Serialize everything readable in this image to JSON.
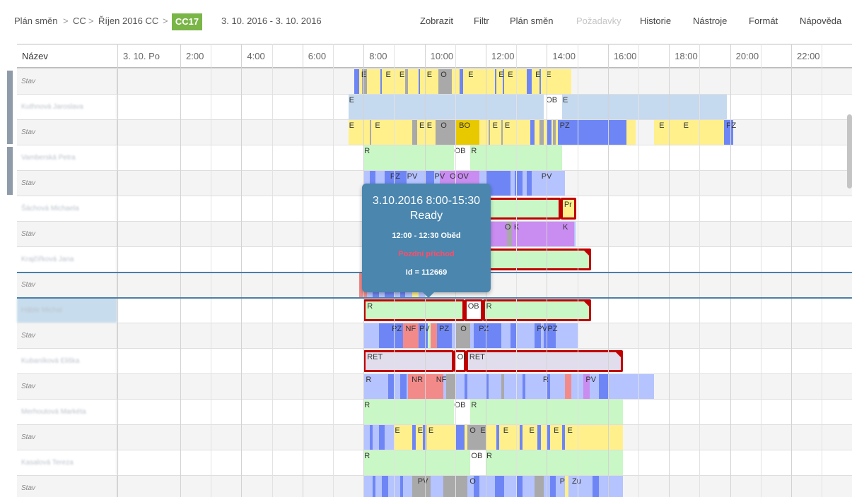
{
  "breadcrumb": {
    "items": [
      "Plán směn",
      "CC",
      "Říjen 2016 CC"
    ],
    "separator": ">",
    "active": "CC17"
  },
  "date_range": "3. 10. 2016 - 3. 10. 2016",
  "menu": [
    {
      "label": "Zobrazit",
      "enabled": true
    },
    {
      "label": "Filtr",
      "enabled": true
    },
    {
      "label": "Plán směn",
      "enabled": true
    },
    {
      "label": "Požadavky",
      "enabled": false
    },
    {
      "label": "Historie",
      "enabled": true
    },
    {
      "label": "Nástroje",
      "enabled": true
    },
    {
      "label": "Formát",
      "enabled": true
    },
    {
      "label": "Nápověda",
      "enabled": true
    }
  ],
  "grid": {
    "name_header": "Název",
    "day_header": "3. 10. Po",
    "hours": [
      "2:00",
      "4:00",
      "6:00",
      "8:00",
      "10:00",
      "12:00",
      "14:00",
      "16:00",
      "18:00",
      "20:00",
      "22:00"
    ],
    "rows": [
      {
        "name": "Stav",
        "kind": "stav"
      },
      {
        "name": "Kuthnová Jaroslava",
        "kind": "person"
      },
      {
        "name": "Stav",
        "kind": "stav"
      },
      {
        "name": "Vamberská Petra",
        "kind": "person"
      },
      {
        "name": "Stav",
        "kind": "stav"
      },
      {
        "name": "Šáchová Michaela",
        "kind": "person"
      },
      {
        "name": "Stav",
        "kind": "stav"
      },
      {
        "name": "Krajčířková Jana",
        "kind": "person"
      },
      {
        "name": "Stav",
        "kind": "stav"
      },
      {
        "name": "Háble Michal",
        "kind": "person",
        "selected": true
      },
      {
        "name": "Stav",
        "kind": "stav"
      },
      {
        "name": "Kubaníková Eliška",
        "kind": "person"
      },
      {
        "name": "Stav",
        "kind": "stav"
      },
      {
        "name": "Merhoutová Markéta",
        "kind": "person"
      },
      {
        "name": "Stav",
        "kind": "stav"
      },
      {
        "name": "Kasalová Tereza",
        "kind": "person"
      },
      {
        "name": "Stav",
        "kind": "stav"
      }
    ]
  },
  "colors": {
    "yellow": "#fff08c",
    "lightblue": "#c5d9ef",
    "green": "#c9f7c5",
    "blue": "#6e86f5",
    "lightviolet": "#b5c3ff",
    "violet": "#c98cf0",
    "gray": "#a9a9a9",
    "red": "#f38a8a",
    "gold": "#e8c900",
    "retfill": "#e2ddec",
    "shiftborder": "#c00000",
    "badge": "#7ab547",
    "tooltip": "#4a86ae"
  },
  "segments": [
    {
      "row": 0,
      "items": [
        {
          "s": 7.7,
          "e": 14.8,
          "c": "yellow"
        },
        {
          "s": 7.7,
          "e": 7.85,
          "c": "blue"
        },
        {
          "s": 7.95,
          "e": 8.1,
          "c": "gray"
        },
        {
          "s": 8.55,
          "e": 8.6,
          "c": "blue"
        },
        {
          "s": 9.35,
          "e": 9.45,
          "c": "gray"
        },
        {
          "s": 9.8,
          "e": 9.85,
          "c": "blue"
        },
        {
          "s": 10.45,
          "e": 10.9,
          "c": "gray"
        },
        {
          "s": 11.15,
          "e": 11.25,
          "c": "blue"
        },
        {
          "s": 12.3,
          "e": 12.35,
          "c": "blue"
        },
        {
          "s": 12.55,
          "e": 12.6,
          "c": "blue"
        },
        {
          "s": 13.35,
          "e": 13.5,
          "c": "blue"
        },
        {
          "s": 13.75,
          "e": 13.8,
          "c": "blue"
        }
      ],
      "labels": [
        {
          "t": "E",
          "x": 7.9
        },
        {
          "t": "E",
          "x": 8.7
        },
        {
          "t": "E",
          "x": 9.15
        },
        {
          "t": "E",
          "x": 10.05
        },
        {
          "t": "O",
          "x": 10.5
        },
        {
          "t": "E",
          "x": 11.4
        },
        {
          "t": "E",
          "x": 12.4
        },
        {
          "t": "E",
          "x": 12.7
        },
        {
          "t": "E",
          "x": 13.6
        },
        {
          "t": "E",
          "x": 13.95
        }
      ]
    },
    {
      "row": 1,
      "items": [
        {
          "s": 7.5,
          "e": 13.9,
          "c": "lightblue"
        },
        {
          "s": 14.5,
          "e": 19.9,
          "c": "lightblue"
        }
      ],
      "labels": [
        {
          "t": "E",
          "x": 7.5
        },
        {
          "t": "OB",
          "x": 13.95
        },
        {
          "t": "E",
          "x": 14.5
        }
      ]
    },
    {
      "row": 2,
      "items": [
        {
          "s": 7.5,
          "e": 16.9,
          "c": "yellow"
        },
        {
          "s": 17.5,
          "e": 19.9,
          "c": "yellow"
        },
        {
          "s": 8.2,
          "e": 8.25,
          "c": "gray"
        },
        {
          "s": 9.6,
          "e": 9.75,
          "c": "gray"
        },
        {
          "s": 10.35,
          "e": 11.0,
          "c": "gray"
        },
        {
          "s": 11.0,
          "e": 11.8,
          "c": "gold"
        },
        {
          "s": 12.1,
          "e": 12.15,
          "c": "gray"
        },
        {
          "s": 12.5,
          "e": 12.55,
          "c": "gray"
        },
        {
          "s": 13.45,
          "e": 13.6,
          "c": "blue"
        },
        {
          "s": 13.75,
          "e": 13.9,
          "c": "gray"
        },
        {
          "s": 14.0,
          "e": 14.15,
          "c": "blue"
        },
        {
          "s": 14.2,
          "e": 14.3,
          "c": "gray"
        },
        {
          "s": 14.35,
          "e": 16.6,
          "c": "blue"
        },
        {
          "s": 19.8,
          "e": 20.1,
          "c": "blue"
        }
      ],
      "labels": [
        {
          "t": "E",
          "x": 7.5
        },
        {
          "t": "E",
          "x": 8.35
        },
        {
          "t": "E",
          "x": 9.8
        },
        {
          "t": "E",
          "x": 10.05
        },
        {
          "t": "O",
          "x": 10.5
        },
        {
          "t": "BO",
          "x": 11.1
        },
        {
          "t": "E",
          "x": 12.2
        },
        {
          "t": "E",
          "x": 12.6
        },
        {
          "t": "PZ",
          "x": 14.4
        },
        {
          "t": "E",
          "x": 17.65
        },
        {
          "t": "E",
          "x": 18.45
        },
        {
          "t": "PZ",
          "x": 19.85
        }
      ]
    },
    {
      "row": 3,
      "items": [
        {
          "s": 8.0,
          "e": 10.95,
          "c": "green"
        },
        {
          "s": 11.5,
          "e": 14.5,
          "c": "green"
        }
      ],
      "labels": [
        {
          "t": "R",
          "x": 8.0
        },
        {
          "t": "OB",
          "x": 10.95
        },
        {
          "t": "R",
          "x": 11.5
        }
      ]
    },
    {
      "row": 4,
      "items": [
        {
          "s": 8.0,
          "e": 14.6,
          "c": "lightviolet"
        },
        {
          "s": 8.2,
          "e": 8.4,
          "c": "blue"
        },
        {
          "s": 8.7,
          "e": 9.4,
          "c": "blue"
        },
        {
          "s": 10.0,
          "e": 10.3,
          "c": "blue"
        },
        {
          "s": 10.5,
          "e": 11.8,
          "c": "violet"
        },
        {
          "s": 12.0,
          "e": 12.8,
          "c": "blue"
        },
        {
          "s": 12.95,
          "e": 13.2,
          "c": "blue"
        },
        {
          "s": 13.35,
          "e": 13.5,
          "c": "blue"
        }
      ],
      "labels": [
        {
          "t": "PZ",
          "x": 8.85
        },
        {
          "t": "PV",
          "x": 9.4
        },
        {
          "t": "PV",
          "x": 10.3
        },
        {
          "t": "O",
          "x": 10.8
        },
        {
          "t": "OV",
          "x": 11.05
        },
        {
          "t": "PV",
          "x": 13.8
        }
      ]
    },
    {
      "row": 6,
      "items": [
        {
          "s": 8.0,
          "e": 14.95,
          "c": "lightviolet"
        },
        {
          "s": 11.9,
          "e": 14.1,
          "c": "violet"
        },
        {
          "s": 14.1,
          "e": 14.9,
          "c": "violet"
        },
        {
          "s": 12.7,
          "e": 12.85,
          "c": "gray"
        }
      ],
      "labels": [
        {
          "t": "O",
          "x": 12.6
        },
        {
          "t": "K",
          "x": 12.9
        },
        {
          "t": "K",
          "x": 14.5
        }
      ]
    },
    {
      "row": 8,
      "items": [
        {
          "s": 7.85,
          "e": 8.1,
          "c": "red"
        },
        {
          "s": 8.1,
          "e": 10.0,
          "c": "lightviolet"
        },
        {
          "s": 8.3,
          "e": 8.5,
          "c": "blue"
        },
        {
          "s": 8.7,
          "e": 9.0,
          "c": "blue"
        },
        {
          "s": 9.2,
          "e": 9.35,
          "c": "blue"
        },
        {
          "s": 9.6,
          "e": 9.8,
          "c": "yellow"
        }
      ],
      "labels": []
    },
    {
      "row": 10,
      "items": [
        {
          "s": 8.0,
          "e": 15.0,
          "c": "lightviolet"
        },
        {
          "s": 8.5,
          "e": 9.3,
          "c": "blue"
        },
        {
          "s": 9.3,
          "e": 9.8,
          "c": "red"
        },
        {
          "s": 9.8,
          "e": 10.1,
          "c": "blue"
        },
        {
          "s": 10.1,
          "e": 10.2,
          "c": "green"
        },
        {
          "s": 10.2,
          "e": 10.4,
          "c": "red"
        },
        {
          "s": 10.4,
          "e": 10.9,
          "c": "blue"
        },
        {
          "s": 11.0,
          "e": 11.5,
          "c": "gray"
        },
        {
          "s": 11.6,
          "e": 12.5,
          "c": "blue"
        },
        {
          "s": 12.8,
          "e": 13.0,
          "c": "blue"
        },
        {
          "s": 13.6,
          "e": 13.8,
          "c": "blue"
        },
        {
          "s": 13.9,
          "e": 14.3,
          "c": "blue"
        }
      ],
      "labels": [
        {
          "t": "PZ",
          "x": 8.9
        },
        {
          "t": "NF",
          "x": 9.35
        },
        {
          "t": "PV",
          "x": 9.8
        },
        {
          "t": "PZ",
          "x": 10.45
        },
        {
          "t": "O",
          "x": 11.15
        },
        {
          "t": "PZ",
          "x": 11.75
        },
        {
          "t": "PV",
          "x": 13.65
        },
        {
          "t": "PZ",
          "x": 14.0
        }
      ]
    },
    {
      "row": 12,
      "items": [
        {
          "s": 8.0,
          "e": 17.5,
          "c": "lightviolet"
        },
        {
          "s": 8.8,
          "e": 9.0,
          "c": "blue"
        },
        {
          "s": 9.2,
          "e": 9.4,
          "c": "blue"
        },
        {
          "s": 9.45,
          "e": 10.3,
          "c": "red"
        },
        {
          "s": 10.3,
          "e": 10.6,
          "c": "red"
        },
        {
          "s": 10.7,
          "e": 11.0,
          "c": "gray"
        },
        {
          "s": 11.3,
          "e": 11.4,
          "c": "blue"
        },
        {
          "s": 12.0,
          "e": 12.1,
          "c": "blue"
        },
        {
          "s": 12.5,
          "e": 12.6,
          "c": "gray"
        },
        {
          "s": 13.2,
          "e": 13.3,
          "c": "blue"
        },
        {
          "s": 14.0,
          "e": 14.1,
          "c": "blue"
        },
        {
          "s": 14.6,
          "e": 14.8,
          "c": "red"
        },
        {
          "s": 15.2,
          "e": 15.4,
          "c": "violet"
        },
        {
          "s": 15.7,
          "e": 16.0,
          "c": "blue"
        }
      ],
      "labels": [
        {
          "t": "R",
          "x": 8.05
        },
        {
          "t": "NR",
          "x": 9.55
        },
        {
          "t": "NF",
          "x": 10.35
        },
        {
          "t": "R",
          "x": 13.85
        },
        {
          "t": "PV",
          "x": 15.25
        }
      ]
    },
    {
      "row": 13,
      "items": [
        {
          "s": 8.0,
          "e": 10.95,
          "c": "green"
        },
        {
          "s": 11.5,
          "e": 16.5,
          "c": "green"
        }
      ],
      "labels": [
        {
          "t": "R",
          "x": 8.0
        },
        {
          "t": "OB",
          "x": 10.95
        },
        {
          "t": "R",
          "x": 11.5
        }
      ]
    },
    {
      "row": 14,
      "items": [
        {
          "s": 8.0,
          "e": 16.5,
          "c": "yellow"
        },
        {
          "s": 8.0,
          "e": 9.0,
          "c": "lightviolet"
        },
        {
          "s": 8.2,
          "e": 8.3,
          "c": "blue"
        },
        {
          "s": 8.5,
          "e": 8.7,
          "c": "blue"
        },
        {
          "s": 9.6,
          "e": 9.7,
          "c": "blue"
        },
        {
          "s": 9.95,
          "e": 10.05,
          "c": "blue"
        },
        {
          "s": 11.0,
          "e": 11.3,
          "c": "blue"
        },
        {
          "s": 11.4,
          "e": 12.0,
          "c": "gray"
        },
        {
          "s": 12.35,
          "e": 12.45,
          "c": "blue"
        },
        {
          "s": 13.1,
          "e": 13.2,
          "c": "blue"
        },
        {
          "s": 13.7,
          "e": 13.8,
          "c": "blue"
        },
        {
          "s": 14.0,
          "e": 14.1,
          "c": "blue"
        },
        {
          "s": 14.5,
          "e": 14.6,
          "c": "blue"
        }
      ],
      "labels": [
        {
          "t": "E",
          "x": 9.0
        },
        {
          "t": "E",
          "x": 9.75
        },
        {
          "t": "E",
          "x": 10.1
        },
        {
          "t": "O",
          "x": 11.45
        },
        {
          "t": "E",
          "x": 11.8
        },
        {
          "t": "E",
          "x": 12.55
        },
        {
          "t": "E",
          "x": 13.4
        },
        {
          "t": "E",
          "x": 14.2
        },
        {
          "t": "E",
          "x": 14.65
        }
      ]
    },
    {
      "row": 15,
      "items": [
        {
          "s": 8.0,
          "e": 11.5,
          "c": "green"
        },
        {
          "s": 12.0,
          "e": 16.5,
          "c": "green"
        }
      ],
      "labels": [
        {
          "t": "R",
          "x": 8.0
        },
        {
          "t": "OB",
          "x": 11.5
        },
        {
          "t": "R",
          "x": 12.0
        }
      ]
    },
    {
      "row": 16,
      "items": [
        {
          "s": 8.0,
          "e": 16.5,
          "c": "lightviolet"
        },
        {
          "s": 8.3,
          "e": 8.4,
          "c": "blue"
        },
        {
          "s": 8.6,
          "e": 8.8,
          "c": "blue"
        },
        {
          "s": 9.2,
          "e": 9.3,
          "c": "blue"
        },
        {
          "s": 9.6,
          "e": 10.2,
          "c": "gray"
        },
        {
          "s": 10.6,
          "e": 11.4,
          "c": "gray"
        },
        {
          "s": 11.6,
          "e": 11.8,
          "c": "blue"
        },
        {
          "s": 12.3,
          "e": 12.6,
          "c": "blue"
        },
        {
          "s": 13.0,
          "e": 13.2,
          "c": "blue"
        },
        {
          "s": 13.6,
          "e": 13.9,
          "c": "gray"
        },
        {
          "s": 14.1,
          "e": 14.3,
          "c": "blue"
        },
        {
          "s": 14.6,
          "e": 14.7,
          "c": "yellow"
        },
        {
          "s": 15.5,
          "e": 15.7,
          "c": "blue"
        }
      ],
      "labels": [
        {
          "t": "PV",
          "x": 9.75
        },
        {
          "t": "O",
          "x": 11.45
        },
        {
          "t": "P",
          "x": 14.4
        },
        {
          "t": "Zu",
          "x": 14.8
        }
      ]
    }
  ],
  "shifts": [
    {
      "row": 5,
      "s": 11.2,
      "e": 14.45,
      "fill": "green",
      "label": ""
    },
    {
      "row": 5,
      "s": 14.45,
      "e": 14.97,
      "fill": "yellow",
      "label": "Pr"
    },
    {
      "row": 7,
      "s": 11.2,
      "e": 15.45,
      "fill": "green",
      "label": "",
      "corner": true
    },
    {
      "row": 9,
      "s": 8.0,
      "e": 11.3,
      "fill": "green",
      "label": "R"
    },
    {
      "row": 9,
      "s": 11.3,
      "e": 11.9,
      "fill": "white",
      "label": "OB"
    },
    {
      "row": 9,
      "s": 11.9,
      "e": 15.45,
      "fill": "green",
      "label": "R",
      "corner": true
    },
    {
      "row": 11,
      "s": 8.0,
      "e": 10.95,
      "fill": "retfill",
      "label": "RET"
    },
    {
      "row": 11,
      "s": 10.95,
      "e": 11.35,
      "fill": "white",
      "label": "OB"
    },
    {
      "row": 11,
      "s": 11.35,
      "e": 16.5,
      "fill": "retfill",
      "label": "RET",
      "corner": true
    }
  ],
  "tooltip": {
    "title": "3.10.2016 8:00-15:30",
    "status": "Ready",
    "break": "12:00 - 12:30 Oběd",
    "late": "Pozdní příchod",
    "id": "Id = 112669"
  }
}
